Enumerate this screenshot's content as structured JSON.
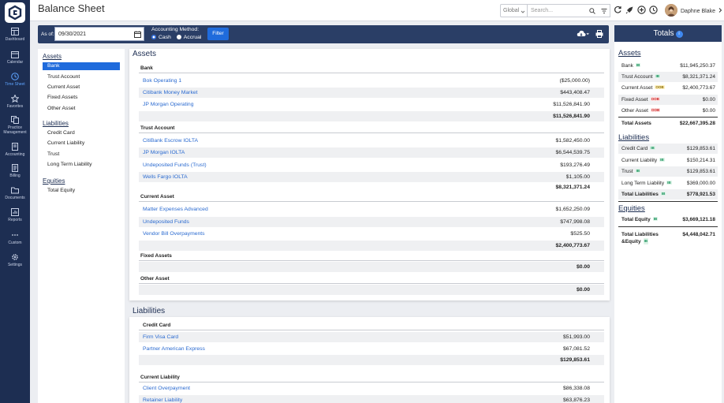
{
  "app": {
    "title": "Balance Sheet"
  },
  "nav": [
    {
      "label": "Dashboard",
      "icon": "dashboard-icon"
    },
    {
      "label": "Calendar",
      "icon": "calendar-icon"
    },
    {
      "label": "Time Sheet",
      "icon": "clock-icon",
      "active": true
    },
    {
      "label": "Favorites",
      "icon": "star-icon"
    },
    {
      "label": "Practice Management",
      "icon": "briefcase-icon"
    },
    {
      "label": "Accounting",
      "icon": "ledger-icon"
    },
    {
      "label": "Billing",
      "icon": "billing-icon"
    },
    {
      "label": "Documents",
      "icon": "folder-icon"
    },
    {
      "label": "Reports",
      "icon": "reports-icon"
    },
    {
      "label": "Custom",
      "icon": "dots-icon"
    },
    {
      "label": "Settings",
      "icon": "gear-icon"
    }
  ],
  "topbar": {
    "scope": "Global",
    "search_placeholder": "Search...",
    "user_name": "Daphne Blake"
  },
  "filter": {
    "asof_label": "As of:",
    "date": "09/30/2021",
    "method_label": "Accounting Method:",
    "method_cash": "Cash",
    "method_accrual": "Accrual",
    "filter_button": "Filter"
  },
  "left_nav": {
    "assets_head": "Assets",
    "assets": [
      "Bank",
      "Trust Account",
      "Current Asset",
      "Fixed Assets",
      "Other Asset"
    ],
    "liabilities_head": "Liabilities",
    "liabilities": [
      "Credit Card",
      "Current Liability",
      "Trust",
      "Long Term Liability"
    ],
    "equities_head": "Equities",
    "equities": [
      "Total Equity"
    ]
  },
  "assets": {
    "title": "Assets",
    "bank": {
      "title": "Bank",
      "rows": [
        {
          "name": "Bok Operating 1",
          "amount": "($25,000.00)"
        },
        {
          "name": "Citibank Money Market",
          "amount": "$443,408.47"
        },
        {
          "name": "JP Morgan Operating",
          "amount": "$11,526,841.90"
        }
      ],
      "total": "$11,526,841.90"
    },
    "trust": {
      "title": "Trust Account",
      "rows": [
        {
          "name": "CitiBank Escrow IOLTA",
          "amount": "$1,582,450.00"
        },
        {
          "name": "JP Morgan IOLTA",
          "amount": "$6,544,539.75"
        },
        {
          "name": "Undeposited Funds (Trust)",
          "amount": "$193,276.49"
        },
        {
          "name": "Wells Fargo IOLTA",
          "amount": "$1,105.00"
        }
      ],
      "total": "$8,321,371.24"
    },
    "current": {
      "title": "Current Asset",
      "rows": [
        {
          "name": "Matter Expenses Advanced",
          "amount": "$1,652,250.09"
        },
        {
          "name": "Undeposited Funds",
          "amount": "$747,998.08"
        },
        {
          "name": "Vendor Bill Overpayments",
          "amount": "$525.50"
        }
      ],
      "total": "$2,400,773.67"
    },
    "fixed": {
      "title": "Fixed Assets",
      "total": "$0.00"
    },
    "other": {
      "title": "Other Asset",
      "total": "$0.00"
    }
  },
  "liabilities": {
    "title": "Liabilities",
    "credit": {
      "title": "Credit Card",
      "rows": [
        {
          "name": "Firm Visa Card",
          "amount": "$51,993.00"
        },
        {
          "name": "Partner American Express",
          "amount": "$67,081.52"
        }
      ],
      "total": "$129,853.61"
    },
    "current": {
      "title": "Current Liability",
      "rows": [
        {
          "name": "Client Overpayment",
          "amount": "$86,338.08"
        },
        {
          "name": "Retainer Liability",
          "amount": "$63,876.23"
        }
      ]
    }
  },
  "totals": {
    "title": "Totals",
    "info": "i",
    "assets_head": "Assets",
    "assets": [
      {
        "label": "Bank",
        "tag": "IB",
        "value": "$11,945,250.37"
      },
      {
        "label": "Trust Account",
        "tag": "IB",
        "value": "$8,321,371.24"
      },
      {
        "label": "Current Asset",
        "tag": "OOB",
        "value": "$2,400,773.67"
      },
      {
        "label": "Fixed Asset",
        "tag": "OOB",
        "value": "$0.00"
      },
      {
        "label": "Other Asset",
        "tag": "OOB",
        "value": "$0.00"
      }
    ],
    "total_assets_label": "Total Assets",
    "total_assets": "$22,667,395.28",
    "liabilities_head": "Liabilities",
    "liabilities": [
      {
        "label": "Credit Card",
        "tag": "IB",
        "value": "$129,853.61"
      },
      {
        "label": "Current Liability",
        "tag": "IB",
        "value": "$150,214.31"
      },
      {
        "label": "Trust",
        "tag": "IB",
        "value": "$129,853.61"
      },
      {
        "label": "Long Term Liability",
        "tag": "IB",
        "value": "$369,000.00"
      }
    ],
    "total_liabilities_label": "Total Liabilities",
    "total_liabilities_tag": "IB",
    "total_liabilities": "$778,921.53",
    "equities_head": "Equities",
    "total_equity_label": "Total Equity",
    "total_equity_tag": "IB",
    "total_equity": "$3,669,121.18",
    "total_le_label_1": "Total Liabilities",
    "total_le_label_2": "&Equity",
    "total_le_tag": "IB",
    "total_le": "$4,448,042.71"
  }
}
